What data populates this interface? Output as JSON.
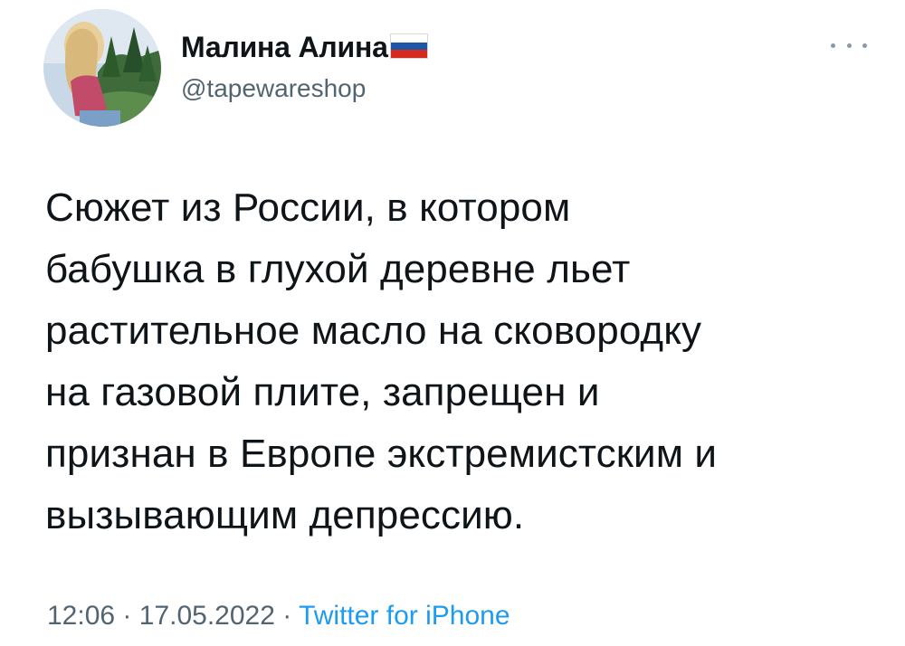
{
  "author": {
    "display_name": "Малина Алина",
    "handle": "@tapewareshop",
    "verified_flag_icon": "russia-flag-icon",
    "avatar_icon": "profile-photo-avatar"
  },
  "more_menu_icon": "more-options-icon",
  "tweet": {
    "lines": [
      "Сюжет из России, в котором",
      "бабушка в глухой деревне льет",
      "растительное масло на сковородку",
      "на газовой плите, запрещен и",
      "признан в Европе экстремистским и",
      "вызывающим депрессию."
    ],
    "time": "12:06",
    "separator": "·",
    "date": "17.05.2022",
    "source": "Twitter for iPhone"
  },
  "colors": {
    "text": "#0f1419",
    "secondary": "#536471",
    "link": "#1d9bf0",
    "flag_white": "#ffffff",
    "flag_blue": "#1c57a5",
    "flag_red": "#d52b1e"
  }
}
